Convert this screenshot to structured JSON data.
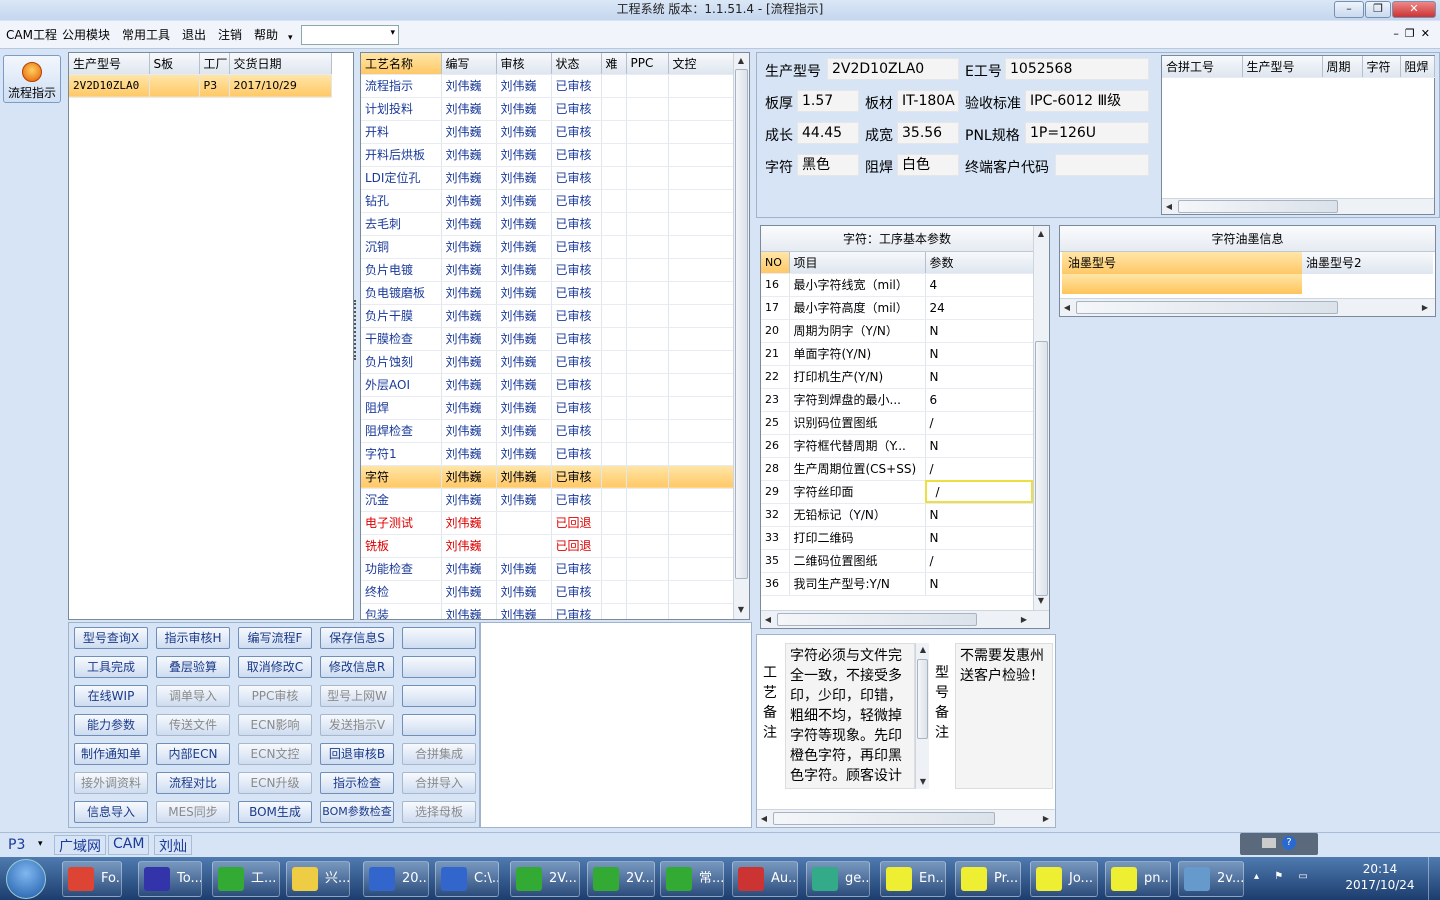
{
  "title": "工程系统   版本：1.1.51.4 - [流程指示]",
  "win_buttons": {
    "min": "–",
    "max": "❐",
    "close": "✕"
  },
  "menu": {
    "items": [
      "CAM工程",
      "公用模块",
      "常用工具",
      "退出",
      "注销",
      "帮助"
    ],
    "help_arrow": "▾",
    "combo_arrow": "▾",
    "mdi": "–❐✕"
  },
  "flow_button": "流程指示",
  "model_grid": {
    "headers": [
      "生产型号",
      "S板",
      "工厂",
      "交货日期"
    ],
    "rows": [
      [
        "2V2D10ZLA0",
        "",
        "P3",
        "2017/10/29"
      ]
    ]
  },
  "process_grid": {
    "headers": [
      "工艺名称",
      "编写",
      "审核",
      "状态",
      "难",
      "PPC",
      "文控"
    ],
    "rows": [
      [
        "流程指示",
        "刘伟巍",
        "刘伟巍",
        "已审核"
      ],
      [
        "计划投料",
        "刘伟巍",
        "刘伟巍",
        "已审核"
      ],
      [
        "开料",
        "刘伟巍",
        "刘伟巍",
        "已审核"
      ],
      [
        "开料后烘板",
        "刘伟巍",
        "刘伟巍",
        "已审核"
      ],
      [
        "LDI定位孔",
        "刘伟巍",
        "刘伟巍",
        "已审核"
      ],
      [
        "钻孔",
        "刘伟巍",
        "刘伟巍",
        "已审核"
      ],
      [
        "去毛刺",
        "刘伟巍",
        "刘伟巍",
        "已审核"
      ],
      [
        "沉铜",
        "刘伟巍",
        "刘伟巍",
        "已审核"
      ],
      [
        "负片电镀",
        "刘伟巍",
        "刘伟巍",
        "已审核"
      ],
      [
        "负电镀磨板",
        "刘伟巍",
        "刘伟巍",
        "已审核"
      ],
      [
        "负片干膜",
        "刘伟巍",
        "刘伟巍",
        "已审核"
      ],
      [
        "干膜检查",
        "刘伟巍",
        "刘伟巍",
        "已审核"
      ],
      [
        "负片蚀刻",
        "刘伟巍",
        "刘伟巍",
        "已审核"
      ],
      [
        "外层AOI",
        "刘伟巍",
        "刘伟巍",
        "已审核"
      ],
      [
        "阻焊",
        "刘伟巍",
        "刘伟巍",
        "已审核"
      ],
      [
        "阻焊检查",
        "刘伟巍",
        "刘伟巍",
        "已审核"
      ],
      [
        "字符1",
        "刘伟巍",
        "刘伟巍",
        "已审核"
      ],
      [
        "字符",
        "刘伟巍",
        "刘伟巍",
        "已审核"
      ],
      [
        "沉金",
        "刘伟巍",
        "刘伟巍",
        "已审核"
      ],
      [
        "电子测试",
        "刘伟巍",
        "",
        "已回退"
      ],
      [
        "铣板",
        "刘伟巍",
        "",
        "已回退"
      ],
      [
        "功能检查",
        "刘伟巍",
        "刘伟巍",
        "已审核"
      ],
      [
        "终检",
        "刘伟巍",
        "刘伟巍",
        "已审核"
      ],
      [
        "包装",
        "刘伟巍",
        "刘伟巍",
        "已审核"
      ]
    ],
    "selected_index": 17,
    "red_indices": [
      19,
      20
    ]
  },
  "buttons": [
    [
      "型号查询X",
      "指示审核H",
      "编写流程F",
      "保存信息S",
      ""
    ],
    [
      "工具完成",
      "叠层验算",
      "取消修改C",
      "修改信息R",
      ""
    ],
    [
      "在线WIP",
      "调单导入",
      "PPC审核",
      "型号上网W",
      ""
    ],
    [
      "能力参数",
      "传送文件",
      "ECN影响",
      "发送指示V",
      ""
    ],
    [
      "制作通知单",
      "内部ECN",
      "ECN文控",
      "回退审核B",
      "合拼集成"
    ],
    [
      "接外调资料",
      "流程对比",
      "ECN升级",
      "指示检查",
      "合拼导入"
    ],
    [
      "信息导入",
      "MES同步",
      "BOM生成",
      "BOM参数检查",
      "选择母板"
    ]
  ],
  "disabled_buttons": [
    "调单导入",
    "PPC审核",
    "型号上网W",
    "传送文件",
    "ECN影响",
    "发送指示V",
    "ECN文控",
    "合拼集成",
    "接外调资料",
    "ECN升级",
    "合拼导入",
    "MES同步",
    "选择母板"
  ],
  "info": {
    "model_label": "生产型号",
    "model": "2V2D10ZLA0",
    "eng_label": "E工号",
    "eng": "1052568",
    "thickness_label": "板厚",
    "thickness": "1.57",
    "material_label": "板材",
    "material": "IT-180A",
    "standard_label": "验收标准",
    "standard": "IPC-6012 Ⅲ级",
    "length_label": "成长",
    "length": "44.45",
    "width_label": "成宽",
    "width": "35.56",
    "pnl_label": "PNL规格",
    "pnl": "1P=126U",
    "char_label": "字符",
    "char": "黑色",
    "mask_label": "阻焊",
    "mask": "白色",
    "customer_label": "终端客户代码",
    "customer": ""
  },
  "combine_grid": {
    "headers": [
      "合拼工号",
      "生产型号",
      "周期",
      "字符",
      "阻焊"
    ]
  },
  "params": {
    "title": "字符：工序基本参数",
    "headers": [
      "NO",
      "项目",
      "参数"
    ],
    "rows": [
      [
        "16",
        "最小字符线宽（mil）",
        "4"
      ],
      [
        "17",
        "最小字符高度（mil）",
        "24"
      ],
      [
        "20",
        "周期为阴字（Y/N）",
        "N"
      ],
      [
        "21",
        "单面字符(Y/N)",
        "N"
      ],
      [
        "22",
        "打印机生产(Y/N)",
        "N"
      ],
      [
        "23",
        "字符到焊盘的最小...",
        "6"
      ],
      [
        "25",
        "识别码位置图纸",
        "/"
      ],
      [
        "26",
        "字符框代替周期（Y...",
        "N"
      ],
      [
        "28",
        "生产周期位置(CS+SS)",
        "/"
      ],
      [
        "29",
        "字符丝印面",
        "/"
      ],
      [
        "32",
        "无铅标记（Y/N）",
        "N"
      ],
      [
        "33",
        "打印二维码",
        "N"
      ],
      [
        "35",
        "二维码位置图纸",
        "/"
      ],
      [
        "36",
        "我司生产型号:Y/N",
        "N"
      ]
    ]
  },
  "ink": {
    "title": "字符油墨信息",
    "headers": [
      "油墨型号",
      "油墨型号2"
    ]
  },
  "notes": {
    "process_label": "工艺备注",
    "process_text": "字符必须与文件完全一致，不接受多印，少印，印错，粗细不均，轻微掉字符等现象。先印橙色字符，再印黑色字符。顾客设计",
    "model_label": "型号备注",
    "model_text": "不需要发惠州送客户检验！"
  },
  "status": {
    "factory": "P3",
    "arrow": "▾",
    "tags": [
      "广域网",
      "CAM",
      "刘灿"
    ]
  },
  "taskbar": {
    "items": [
      "Fo...",
      "To...",
      "工...",
      "兴...",
      "20...",
      "C:\\...",
      "2V...",
      "2V...",
      "常...",
      "Au...",
      "ge...",
      "En...",
      "Pr...",
      "Jo...",
      "pn...",
      "2v..."
    ],
    "time": "20:14",
    "date": "2017/10/24"
  },
  "colors": {
    "accent": "#ffc866",
    "blue_text": "#1a3a9a",
    "red_text": "#dd0000"
  }
}
